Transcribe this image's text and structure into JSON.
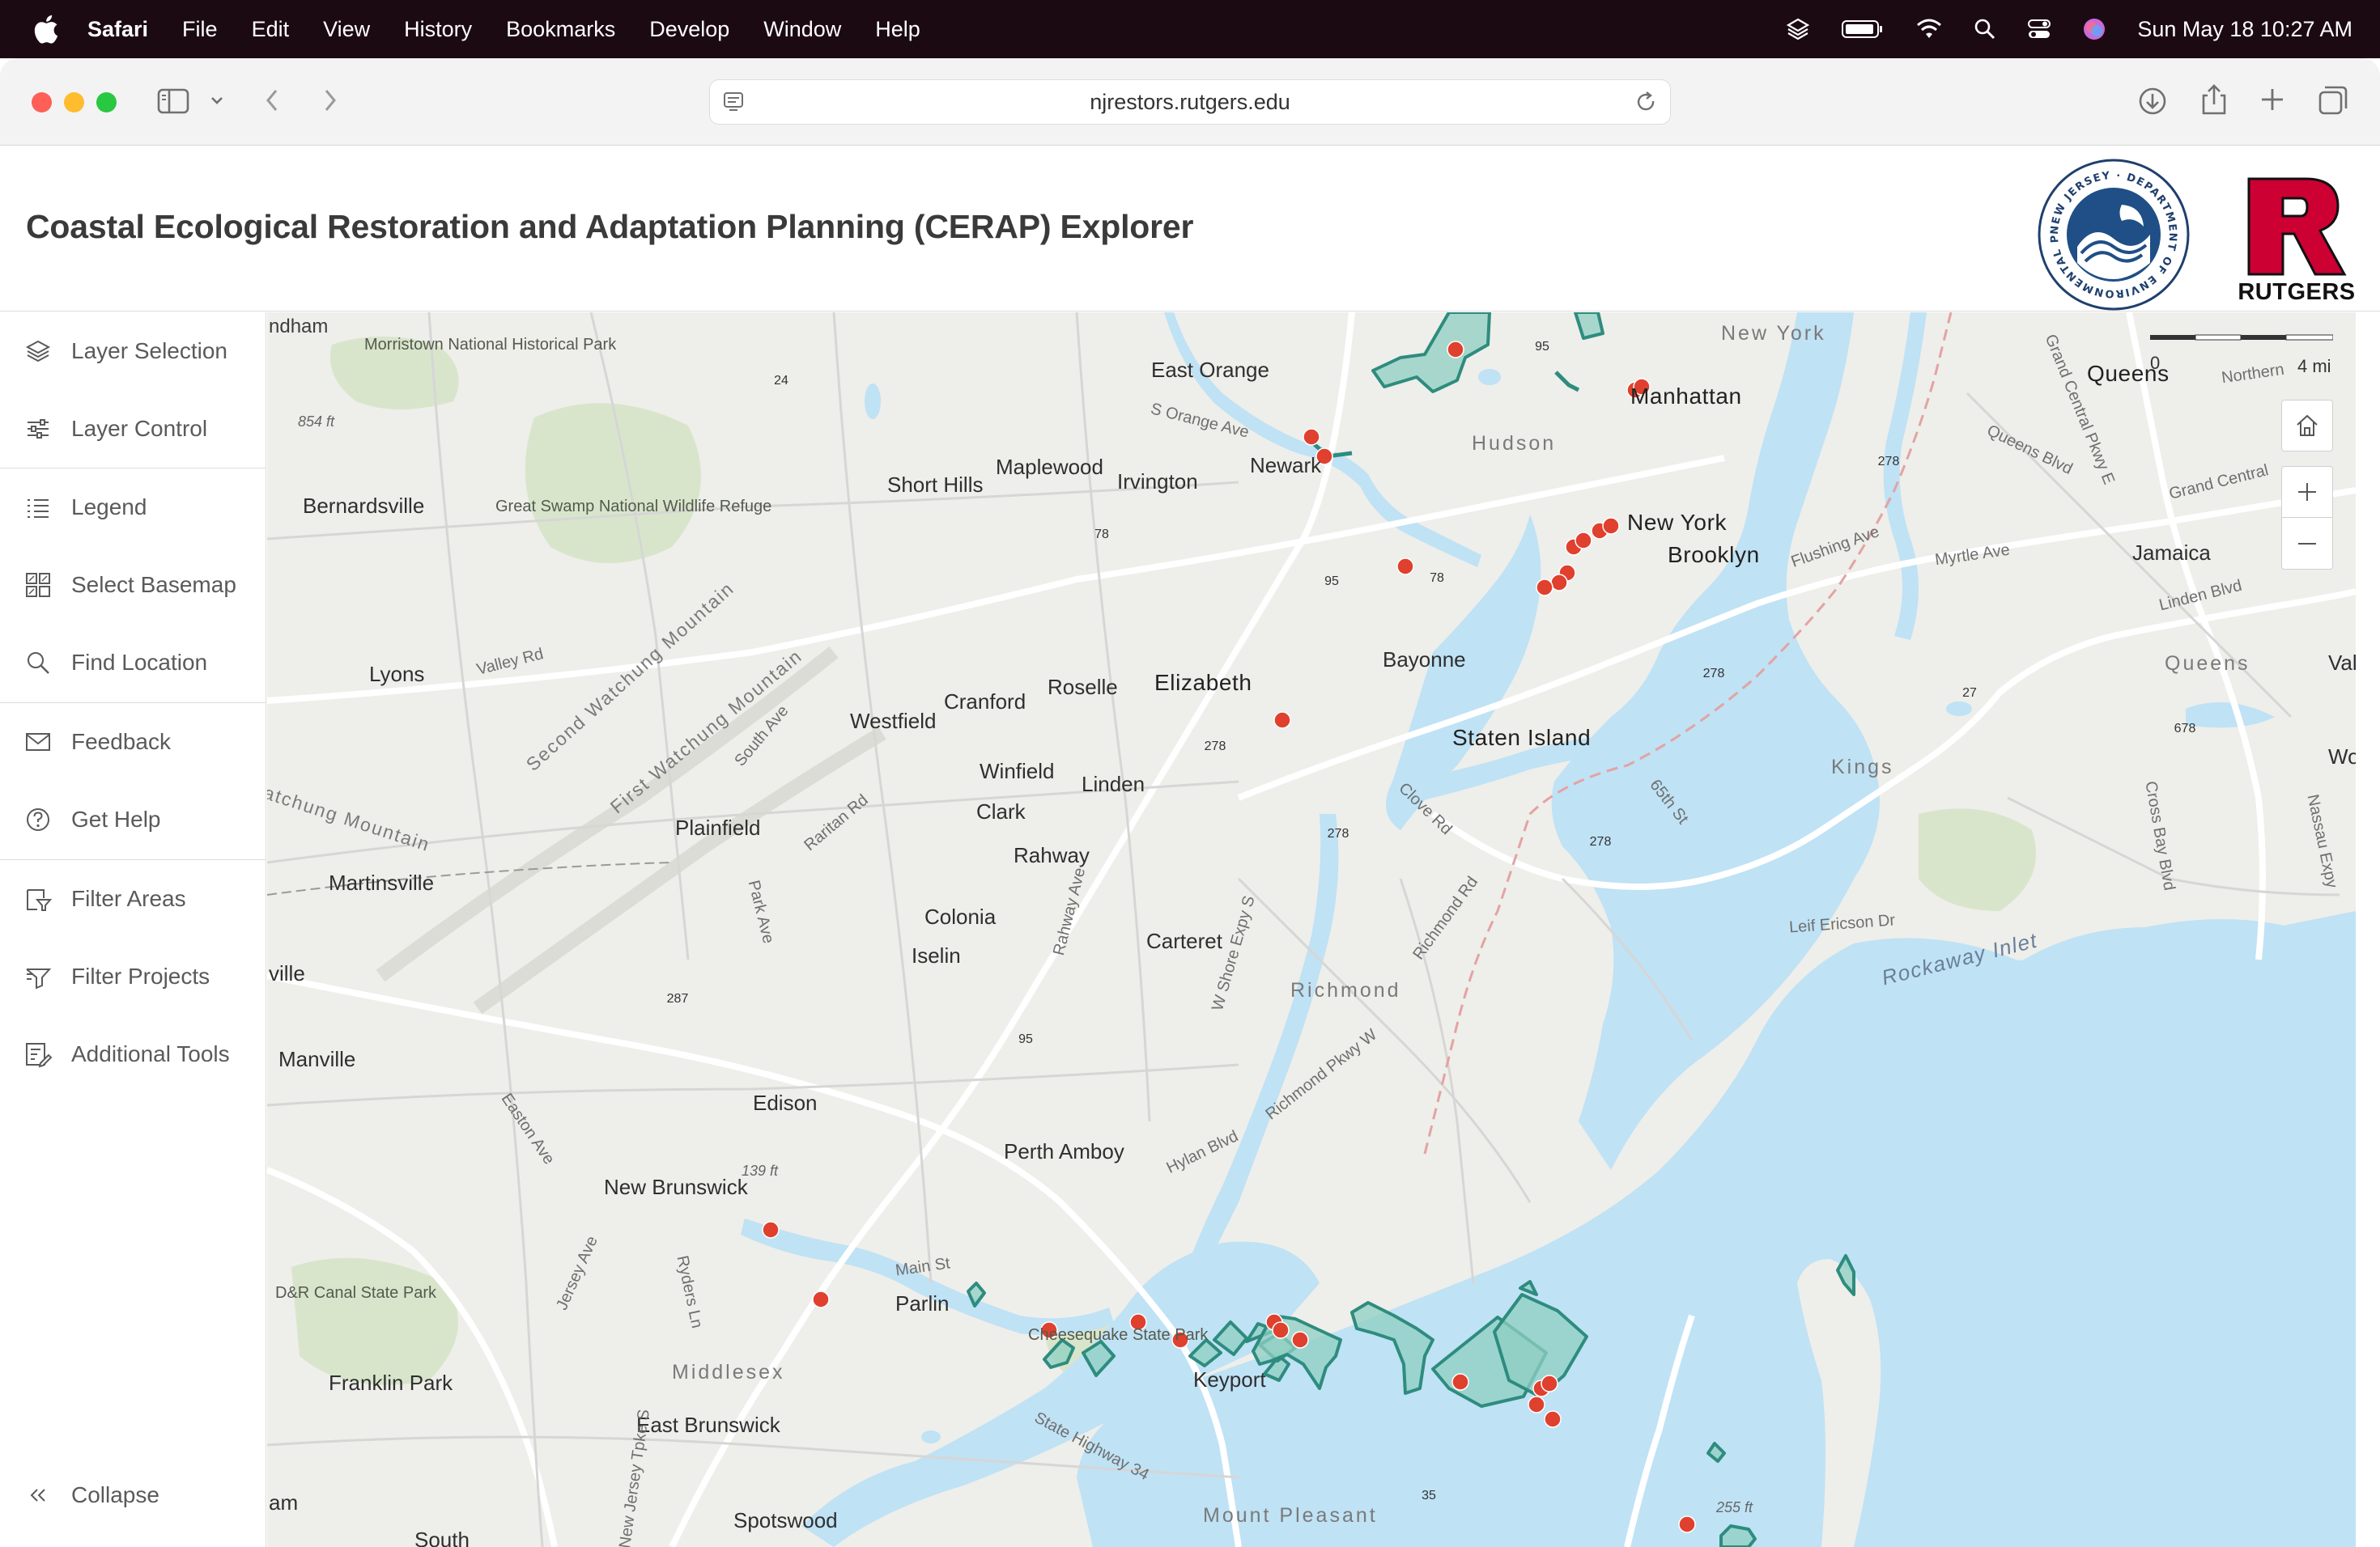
{
  "menubar": {
    "app_name": "Safari",
    "items": [
      "File",
      "Edit",
      "View",
      "History",
      "Bookmarks",
      "Develop",
      "Window",
      "Help"
    ],
    "clock": "Sun May 18  10:27 AM"
  },
  "browser": {
    "url": "njrestors.rutgers.edu"
  },
  "header": {
    "title": "Coastal Ecological Restoration and Adaptation Planning (CERAP) Explorer",
    "seal_text": "NEW JERSEY · DEPARTMENT OF ENVIRONMENTAL PROTECTION",
    "rutgers_letter": "R",
    "rutgers_word": "RUTGERS"
  },
  "sidebar": {
    "items": [
      {
        "label": "Layer Selection",
        "icon": "layers-icon"
      },
      {
        "label": "Layer Control",
        "icon": "sliders-icon"
      },
      {
        "label": "Legend",
        "icon": "list-icon"
      },
      {
        "label": "Select Basemap",
        "icon": "basemap-grid-icon"
      },
      {
        "label": "Find Location",
        "icon": "search-icon"
      },
      {
        "label": "Feedback",
        "icon": "envelope-icon"
      },
      {
        "label": "Get Help",
        "icon": "question-circle-icon"
      },
      {
        "label": "Filter Areas",
        "icon": "filter-areas-icon"
      },
      {
        "label": "Filter Projects",
        "icon": "filter-projects-icon"
      },
      {
        "label": "Additional Tools",
        "icon": "tools-icon"
      }
    ],
    "collapse_label": "Collapse"
  },
  "map": {
    "scale_start": "0",
    "scale_end": "4 mi",
    "labels": {
      "ndham": "ndham",
      "morristown": "Morristown National Historical Park",
      "east_orange": "East Orange",
      "new_york_top": "New York",
      "queens": "Queens",
      "northern_blvd": "Northern",
      "manhattan": "Manhattan",
      "s_orange_ave": "S Orange Ave",
      "hudson": "Hudson",
      "newark": "Newark",
      "maplewood": "Maplewood",
      "irvington": "Irvington",
      "short_hills": "Short Hills",
      "bernardsville": "Bernardsville",
      "great_swamp": "Great Swamp National Wildlife Refuge",
      "new_york": "New York",
      "brooklyn": "Brooklyn",
      "queens_blvd": "Queens Blvd",
      "grand_central_pkwy": "Grand Central Pkwy E",
      "grand_central": "Grand Central",
      "jamaica": "Jamaica",
      "flushing_ave": "Flushing Ave",
      "myrtle_ave": "Myrtle Ave",
      "linden_blvd": "Linden Blvd",
      "queens_area": "Queens",
      "val": "Val",
      "lyons": "Lyons",
      "valley_rd": "Valley Rd",
      "second_watchung": "Second Watchung Mountain",
      "first_watchung": "First Watchung Mountain",
      "elizabeth": "Elizabeth",
      "bayonne": "Bayonne",
      "roselle": "Roselle",
      "cranford": "Cranford",
      "westfield": "Westfield",
      "staten_island": "Staten Island",
      "kings": "Kings",
      "woo": "Woo",
      "watchung_mountain": "atchung Mountain",
      "south_ave": "South Ave",
      "winfield": "Winfield",
      "linden": "Linden",
      "clark": "Clark",
      "raritan_rd": "Raritan Rd",
      "plainfield": "Plainfield",
      "rahway": "Rahway",
      "clove_rd": "Clove Rd",
      "65th_st": "65th St",
      "cross_bay_blvd": "Cross Bay Blvd",
      "nassau_expy": "Nassau Expy",
      "martinsville": "Martinsville",
      "colonia": "Colonia",
      "iselin": "Iselin",
      "park_ave": "Park Ave",
      "rahway_ave": "Rahway Ave",
      "carteret": "Carteret",
      "w_shore_expy": "W Shore Expy S",
      "richmond_rd": "Richmond Rd",
      "leif_ericson": "Leif Ericson Dr",
      "rockaway_inlet": "Rockaway Inlet",
      "richmond": "Richmond",
      "ville": "ville",
      "manville": "Manville",
      "richmond_pkwy": "Richmond Pkwy W",
      "easton_ave": "Easton Ave",
      "edison": "Edison",
      "hylan_blvd": "Hylan Blvd",
      "perth_amboy": "Perth Amboy",
      "new_brunswick": "New Brunswick",
      "elev_139": "139 ft",
      "elev_854": "854 ft",
      "elev_255": "255 ft",
      "main_st": "Main St",
      "parlin": "Parlin",
      "dr_canal": "D&R Canal State Park",
      "cheesequake": "Cheesequake State Park",
      "keyport": "Keyport",
      "jersey_ave": "Jersey Ave",
      "ryders_ln": "Ryders Ln",
      "middlesex": "Middlesex",
      "franklin_park": "Franklin Park",
      "east_brunswick": "East Brunswick",
      "state_highway_34": "State Highway 34",
      "am": "am",
      "spotswood": "Spotswood",
      "mount_pleasant": "Mount Pleasant",
      "south": "South",
      "nj_tpke": "New Jersey Tpke S"
    },
    "shields": {
      "i95a": "95",
      "r24": "24",
      "i78a": "78",
      "i95b": "95",
      "i78b": "78",
      "i278a": "278",
      "i278b": "278",
      "r27": "27",
      "i278c": "278",
      "i278d": "278",
      "i678": "678",
      "i278e": "278",
      "i287": "287",
      "i95c": "95",
      "r35": "35"
    }
  },
  "colors": {
    "menubar_bg": "#1c0a12",
    "water": "#bfe2f5",
    "land": "#eeeeea",
    "project_area_fill": "#8fcfc2",
    "project_area_stroke": "#2e8c7e",
    "project_point": "#e0402e",
    "rutgers_red": "#cc0033"
  }
}
